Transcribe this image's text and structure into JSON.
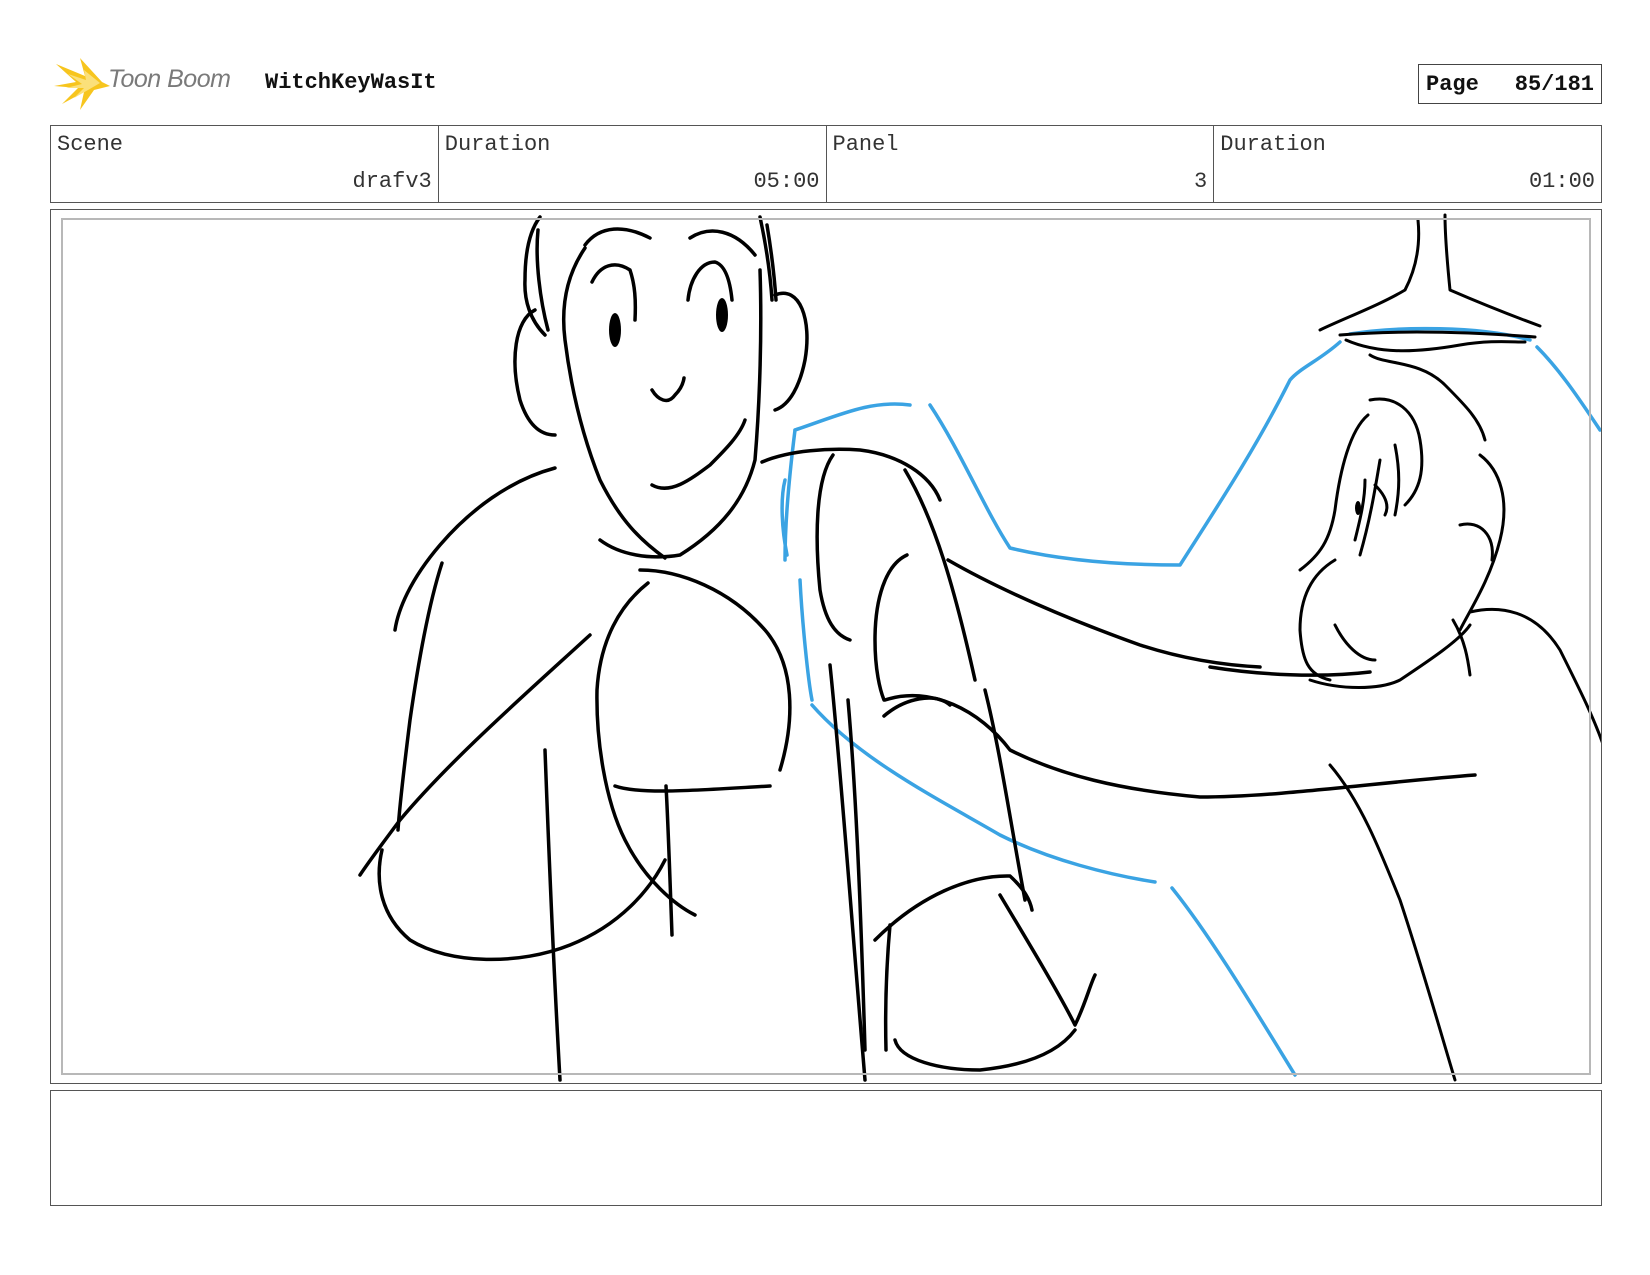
{
  "header": {
    "logo_text": "Toon Boom",
    "project_title": "WitchKeyWasIt",
    "page_label": "Page",
    "page_number": "85/181"
  },
  "info": [
    {
      "label": "Scene",
      "value": "drafv3"
    },
    {
      "label": "Duration",
      "value": "05:00"
    },
    {
      "label": "Panel",
      "value": "3"
    },
    {
      "label": "Duration",
      "value": "01:00"
    }
  ],
  "colors": {
    "ink": "#000000",
    "guide_blue": "#3aa3e3",
    "logo_yellow": "#f7c51e",
    "logo_text": "#7a7a7a"
  },
  "notes": {
    "text": ""
  }
}
